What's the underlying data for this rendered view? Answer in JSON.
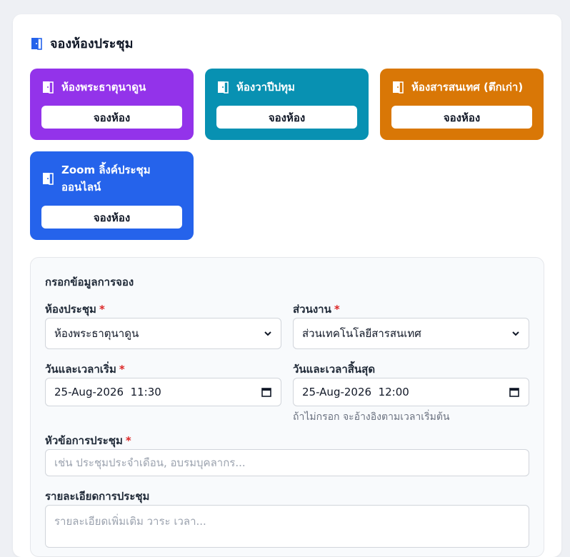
{
  "header": {
    "title": "จองห้องประชุม"
  },
  "rooms": [
    {
      "name": "ห้องพระธาตุนาดูน",
      "book_label": "จองห้อง",
      "color": "#9333ea"
    },
    {
      "name": "ห้องวาปีปทุม",
      "book_label": "จองห้อง",
      "color": "#0891b2"
    },
    {
      "name": "ห้องสารสนเทศ (ตึกเก่า)",
      "book_label": "จองห้อง",
      "color": "#d97706"
    },
    {
      "name": "Zoom ลิ้งค์ประชุมออนไลน์",
      "name_line1": "Zoom ลิ้งค์ประชุม",
      "name_line2": "ออนไลน์",
      "book_label": "จองห้อง",
      "color": "#2563eb"
    }
  ],
  "form": {
    "title": "กรอกข้อมูลการจอง",
    "room": {
      "label": "ห้องประชุม",
      "required": "*",
      "value": "ห้องพระธาตุนาดูน"
    },
    "department": {
      "label": "ส่วนงาน",
      "required": "*",
      "value": "ส่วนเทคโนโลยีสารสนเทศ"
    },
    "start": {
      "label": "วันและเวลาเริ่ม",
      "required": "*",
      "value": "25-Aug-2026  11:30"
    },
    "end": {
      "label": "วันและเวลาสิ้นสุด",
      "value": "25-Aug-2026  12:00",
      "hint": "ถ้าไม่กรอก จะอ้างอิงตามเวลาเริ่มต้น"
    },
    "topic": {
      "label": "หัวข้อการประชุม",
      "required": "*",
      "placeholder": "เช่น ประชุมประจำเดือน, อบรมบุคลากร..."
    },
    "details": {
      "label": "รายละเอียดการประชุม",
      "placeholder": "รายละเอียดเพิ่มเติม วาระ เวลา..."
    }
  }
}
